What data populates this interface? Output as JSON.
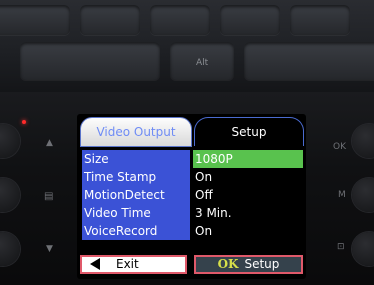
{
  "keyboard": {
    "alt_key": "Alt"
  },
  "device": {
    "right_labels": {
      "ok": "OK",
      "menu": "M"
    }
  },
  "screen": {
    "tabs": [
      {
        "label": "Video Output",
        "active": true
      },
      {
        "label": "Setup",
        "active": false
      }
    ],
    "settings": [
      {
        "label": "Size",
        "value": "1080P",
        "selected": true
      },
      {
        "label": "Time Stamp",
        "value": "On",
        "selected": false
      },
      {
        "label": "MotionDetect",
        "value": "Off",
        "selected": false
      },
      {
        "label": "Video Time",
        "value": "3 Min.",
        "selected": false
      },
      {
        "label": "VoiceRecord",
        "value": "On",
        "selected": false
      }
    ],
    "buttons": {
      "exit_label": "Exit",
      "ok_label": "OK",
      "setup_label": "Setup"
    }
  },
  "colors": {
    "row_label_bg": "#3b52d6",
    "selected_value_bg": "#59c24e",
    "button_border": "#e0596a",
    "ok_text": "#d7e04a"
  }
}
